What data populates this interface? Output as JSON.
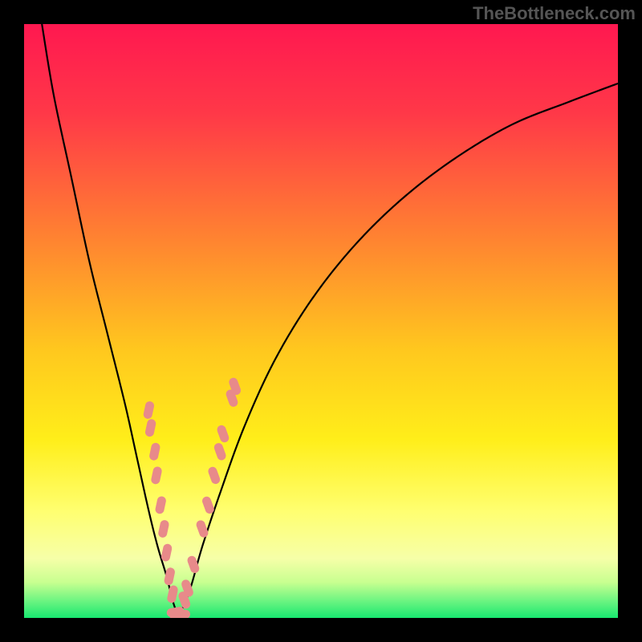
{
  "watermark": "TheBottleneck.com",
  "chart_data": {
    "type": "line",
    "title": "",
    "xlabel": "",
    "ylabel": "",
    "xlim": [
      0,
      100
    ],
    "ylim": [
      0,
      100
    ],
    "description": "V-shaped bottleneck curve with minimum around x=26%. Two curves: left descending steeply from top, right ascending more gradually.",
    "curve_left": {
      "x": [
        3,
        5,
        8,
        11,
        14,
        17,
        19,
        21,
        22.5,
        24,
        25,
        26
      ],
      "y": [
        100,
        88,
        74,
        60,
        48,
        36,
        27,
        18,
        12,
        7,
        3,
        0
      ]
    },
    "curve_right": {
      "x": [
        26,
        28,
        30,
        33,
        37,
        42,
        48,
        55,
        63,
        72,
        82,
        92,
        100
      ],
      "y": [
        0,
        5,
        12,
        21,
        32,
        43,
        53,
        62,
        70,
        77,
        83,
        87,
        90
      ]
    },
    "highlighted_points_left": [
      {
        "x": 21,
        "y": 35
      },
      {
        "x": 21.3,
        "y": 32
      },
      {
        "x": 22,
        "y": 28
      },
      {
        "x": 22.3,
        "y": 24
      },
      {
        "x": 23,
        "y": 19
      },
      {
        "x": 23.5,
        "y": 15
      },
      {
        "x": 24,
        "y": 11
      },
      {
        "x": 24.5,
        "y": 7
      },
      {
        "x": 25,
        "y": 4
      }
    ],
    "highlighted_points_right": [
      {
        "x": 27,
        "y": 3
      },
      {
        "x": 27.5,
        "y": 5
      },
      {
        "x": 28.5,
        "y": 9
      },
      {
        "x": 30,
        "y": 15
      },
      {
        "x": 31,
        "y": 19
      },
      {
        "x": 32,
        "y": 24
      },
      {
        "x": 33,
        "y": 28
      },
      {
        "x": 33.5,
        "y": 31
      },
      {
        "x": 35,
        "y": 37
      },
      {
        "x": 35.5,
        "y": 39
      }
    ],
    "highlighted_bottom": [
      {
        "x": 25.5,
        "y": 1
      },
      {
        "x": 26,
        "y": 0.5
      },
      {
        "x": 26.5,
        "y": 0.5
      }
    ],
    "gradient_stops": [
      {
        "offset": 0,
        "color": "#ff1850"
      },
      {
        "offset": 0.15,
        "color": "#ff3848"
      },
      {
        "offset": 0.35,
        "color": "#ff7f32"
      },
      {
        "offset": 0.55,
        "color": "#ffc81e"
      },
      {
        "offset": 0.7,
        "color": "#ffee1a"
      },
      {
        "offset": 0.82,
        "color": "#ffff70"
      },
      {
        "offset": 0.9,
        "color": "#f6ffa8"
      },
      {
        "offset": 0.94,
        "color": "#c8ff90"
      },
      {
        "offset": 0.97,
        "color": "#70f582"
      },
      {
        "offset": 1.0,
        "color": "#18e870"
      }
    ],
    "colors": {
      "curve": "#000000",
      "highlight": "#e88a8a",
      "background_frame": "#000000"
    }
  }
}
